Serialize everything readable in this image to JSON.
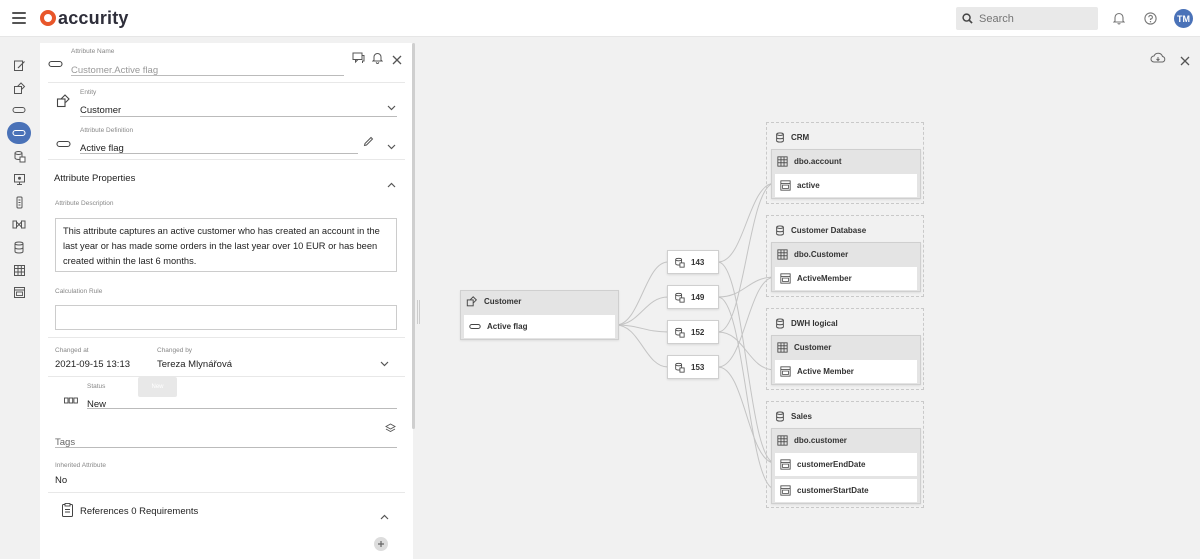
{
  "app": {
    "logo_text": "accurity"
  },
  "topbar": {
    "search_placeholder": "Search",
    "avatar_initials": "TM"
  },
  "panel": {
    "attribute_name_label": "Attribute Name",
    "attribute_name_value": "Customer.Active flag",
    "entity_label": "Entity",
    "entity_value": "Customer",
    "attr_def_label": "Attribute Definition",
    "attr_def_value": "Active flag",
    "properties_title": "Attribute Properties",
    "description_label": "Attribute Description",
    "description_value": "This attribute captures an active customer who has created an account in the last year or has made some orders in the last year over 10 EUR or has been created within the last 6 months.",
    "calc_rule_label": "Calculation Rule",
    "calc_rule_value": "",
    "changed_at_label": "Changed at",
    "changed_at_value": "2021-09-15 13:13",
    "changed_by_label": "Changed by",
    "changed_by_value": "Tereza Mlynářová",
    "status_label": "Status",
    "status_value": "New",
    "status_tooltip": "New",
    "tags_placeholder": "Tags",
    "inherited_label": "Inherited Attribute",
    "inherited_value": "No",
    "references_label": "References 0 Requirements"
  },
  "graph": {
    "source": {
      "entity": "Customer",
      "attribute": "Active flag"
    },
    "references": [
      "143",
      "149",
      "152",
      "153"
    ],
    "groups": [
      {
        "name": "CRM",
        "table": "dbo.account",
        "columns": [
          "active"
        ]
      },
      {
        "name": "Customer Database",
        "table": "dbo.Customer",
        "columns": [
          "ActiveMember"
        ]
      },
      {
        "name": "DWH logical",
        "table": "Customer",
        "columns": [
          "Active Member"
        ]
      },
      {
        "name": "Sales",
        "table": "dbo.customer",
        "columns": [
          "customerEndDate",
          "customerStartDate"
        ]
      }
    ]
  }
}
